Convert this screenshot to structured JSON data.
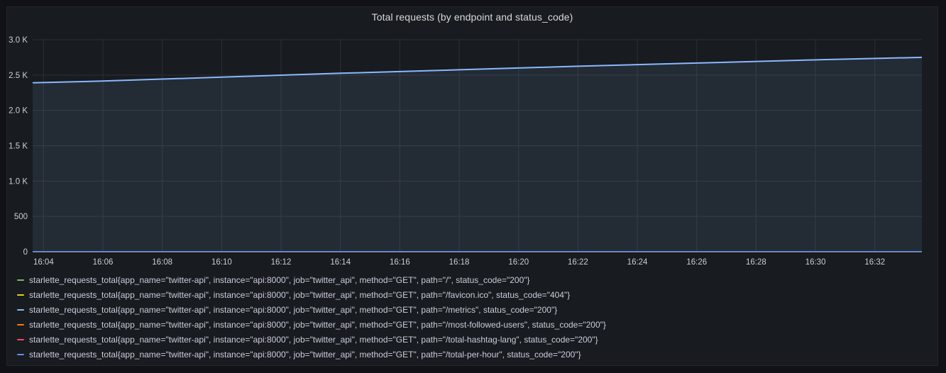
{
  "panel": {
    "title": "Total requests (by endpoint and status_code)"
  },
  "colors": {
    "background": "#111217",
    "panel": "#181b1f",
    "grid": "#2c3035",
    "text": "#ccccdc"
  },
  "chart_data": {
    "type": "line",
    "title": "Total requests (by endpoint and status_code)",
    "xlabel": "",
    "ylabel": "",
    "ylim": [
      0,
      3000
    ],
    "y_ticks": [
      0,
      500,
      1000,
      1500,
      2000,
      2500,
      3000
    ],
    "y_tick_labels": [
      "0",
      "500",
      "1.0 K",
      "1.5 K",
      "2.0 K",
      "2.5 K",
      "3.0 K"
    ],
    "xlim": [
      "16:03:38",
      "16:33:35"
    ],
    "x_ticks": [
      "16:04",
      "16:06",
      "16:08",
      "16:10",
      "16:12",
      "16:14",
      "16:16",
      "16:18",
      "16:20",
      "16:22",
      "16:24",
      "16:26",
      "16:28",
      "16:30",
      "16:32"
    ],
    "grid": true,
    "legend_position": "bottom",
    "series": [
      {
        "name": "starlette_requests_total{app_name=\"twitter-api\", instance=\"api:8000\", job=\"twitter_api\", method=\"GET\", path=\"/\", status_code=\"200\"}",
        "color": "#73bf69",
        "x": [
          "16:03:38",
          "16:33:35"
        ],
        "y": [
          1,
          1
        ]
      },
      {
        "name": "starlette_requests_total{app_name=\"twitter-api\", instance=\"api:8000\", job=\"twitter_api\", method=\"GET\", path=\"/favicon.ico\", status_code=\"404\"}",
        "color": "#f2cc0c",
        "x": [
          "16:03:38",
          "16:33:35"
        ],
        "y": [
          1,
          1
        ]
      },
      {
        "name": "starlette_requests_total{app_name=\"twitter-api\", instance=\"api:8000\", job=\"twitter_api\", method=\"GET\", path=\"/metrics\", status_code=\"200\"}",
        "color": "#8ab8ff",
        "fill": true,
        "x": [
          "16:03:38",
          "16:06",
          "16:10",
          "16:14",
          "16:18",
          "16:22",
          "16:26",
          "16:30",
          "16:33:35"
        ],
        "y": [
          2390,
          2415,
          2470,
          2525,
          2575,
          2625,
          2670,
          2715,
          2750
        ]
      },
      {
        "name": "starlette_requests_total{app_name=\"twitter-api\", instance=\"api:8000\", job=\"twitter_api\", method=\"GET\", path=\"/most-followed-users\", status_code=\"200\"}",
        "color": "#ff780a",
        "x": [
          "16:03:38",
          "16:33:35"
        ],
        "y": [
          1,
          1
        ]
      },
      {
        "name": "starlette_requests_total{app_name=\"twitter-api\", instance=\"api:8000\", job=\"twitter_api\", method=\"GET\", path=\"/total-hashtag-lang\", status_code=\"200\"}",
        "color": "#f2495c",
        "x": [
          "16:03:38",
          "16:33:35"
        ],
        "y": [
          1,
          1
        ]
      },
      {
        "name": "starlette_requests_total{app_name=\"twitter-api\", instance=\"api:8000\", job=\"twitter_api\", method=\"GET\", path=\"/total-per-hour\", status_code=\"200\"}",
        "color": "#5794f2",
        "x": [
          "16:03:38",
          "16:33:35"
        ],
        "y": [
          2,
          2
        ]
      }
    ]
  }
}
